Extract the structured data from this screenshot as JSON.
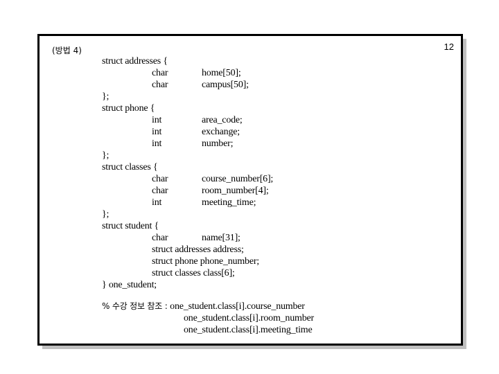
{
  "page_number": "12",
  "heading": "(방법 4)",
  "structs": {
    "addresses": {
      "open": "struct addresses {",
      "fields": [
        {
          "type": "char",
          "name": "home[50];"
        },
        {
          "type": "char",
          "name": "campus[50];"
        }
      ],
      "close": "};"
    },
    "phone": {
      "open": "struct phone {",
      "fields": [
        {
          "type": "int",
          "name": "area_code;"
        },
        {
          "type": "int",
          "name": "exchange;"
        },
        {
          "type": "int",
          "name": "number;"
        }
      ],
      "close": "};"
    },
    "classes": {
      "open": "struct classes {",
      "fields": [
        {
          "type": "char",
          "name": "course_number[6];"
        },
        {
          "type": "char",
          "name": "room_number[4];"
        },
        {
          "type": "int",
          "name": "meeting_time;"
        }
      ],
      "close": "};"
    },
    "student": {
      "open": "struct student {",
      "name_field": {
        "type": "char",
        "name": "name[31];"
      },
      "members": [
        "struct addresses address;",
        "struct phone phone_number;",
        "struct classes class[6];"
      ],
      "close": "} one_student;"
    }
  },
  "note": {
    "prefix": "% 수강 정보 참조 : ",
    "lines": [
      "one_student.class[i].course_number",
      "one_student.class[i].room_number",
      "one_student.class[i].meeting_time"
    ]
  }
}
